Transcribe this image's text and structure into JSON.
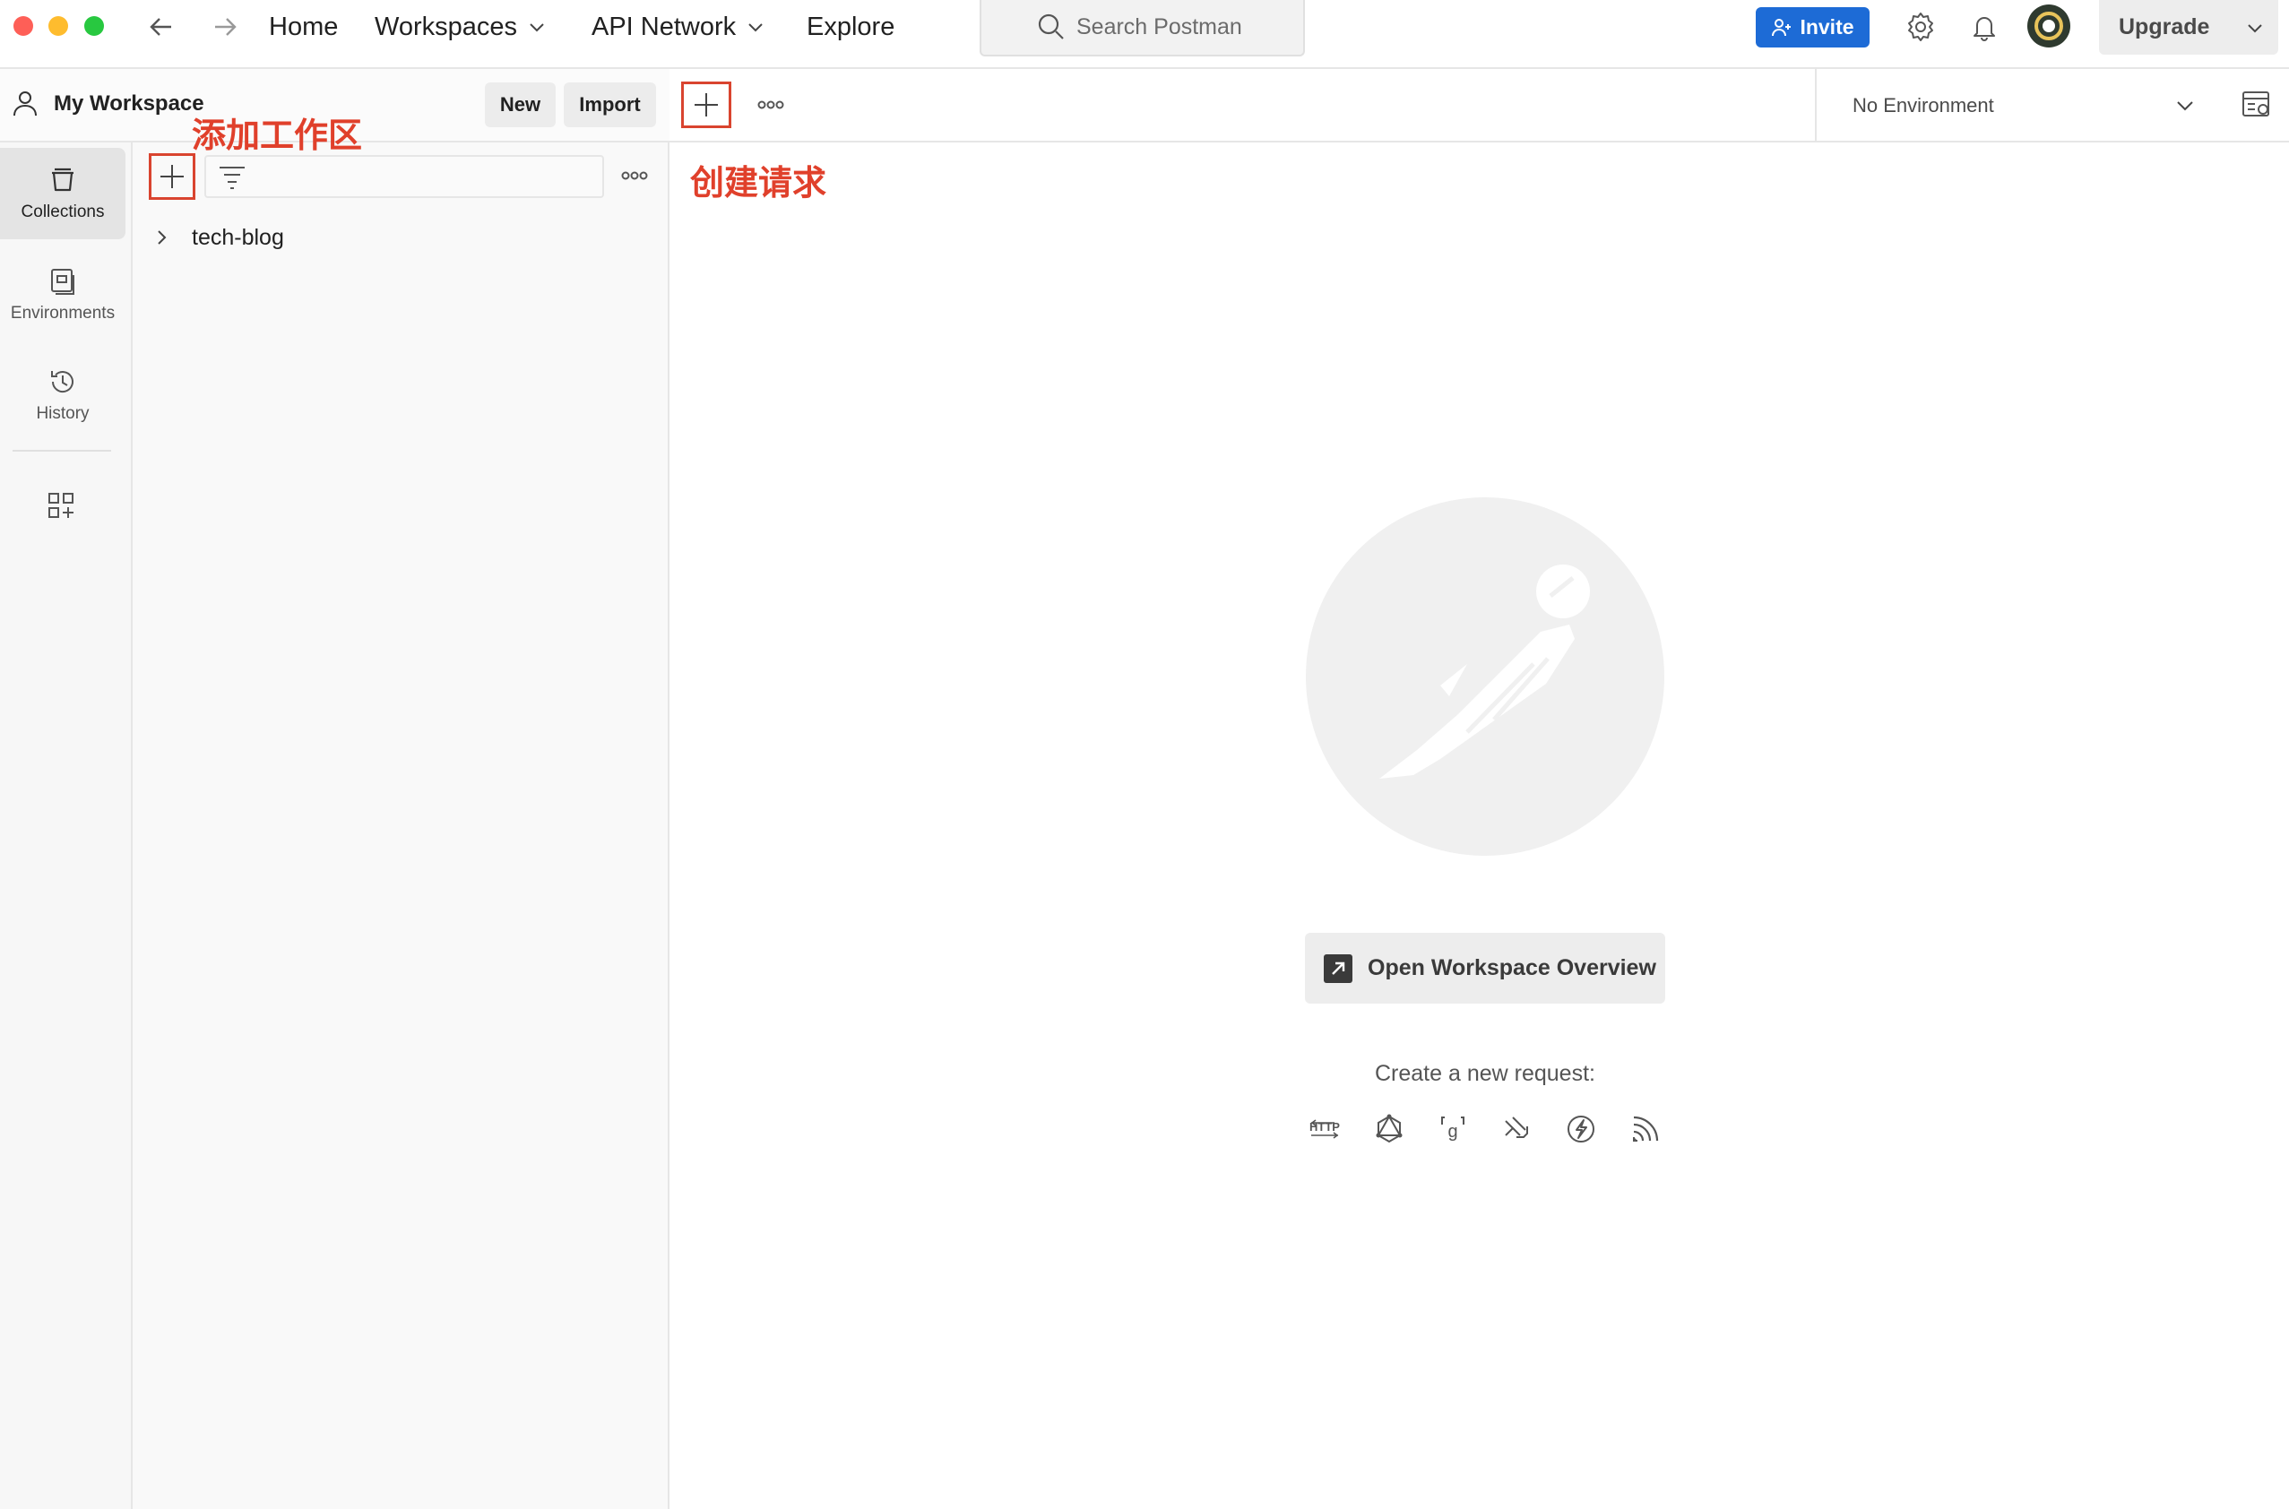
{
  "topbar": {
    "nav": {
      "home": "Home",
      "workspaces": "Workspaces",
      "api_network": "API Network",
      "explore": "Explore"
    },
    "search_placeholder": "Search Postman",
    "invite_label": "Invite",
    "upgrade_label": "Upgrade"
  },
  "rail": {
    "items": [
      {
        "label": "Collections",
        "icon": "collections-icon",
        "active": true
      },
      {
        "label": "Environments",
        "icon": "environments-icon"
      },
      {
        "label": "History",
        "icon": "history-icon"
      }
    ],
    "extra_icon": "apps-icon"
  },
  "sidebar": {
    "workspace_title": "My Workspace",
    "new_label": "New",
    "import_label": "Import",
    "annotation": "添加工作区",
    "tree": [
      {
        "label": "tech-blog"
      }
    ]
  },
  "main": {
    "annotation": "创建请求",
    "environment": "No Environment",
    "overview_button": "Open Workspace Overview",
    "create_label": "Create a new request:",
    "request_icons": [
      "http-icon",
      "graphql-icon",
      "grpc-icon",
      "websocket-icon",
      "socketio-icon",
      "mqtt-icon"
    ]
  },
  "colors": {
    "accent": "#1d6bd6",
    "annotation_red": "#e0402b",
    "traffic_red": "#fe5f57",
    "traffic_yellow": "#febc2e",
    "traffic_green": "#28c840"
  }
}
